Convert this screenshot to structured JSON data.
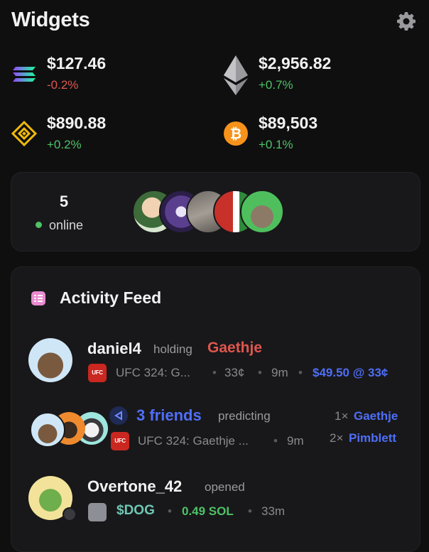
{
  "header": {
    "title": "Widgets",
    "settings_icon": "gear-icon"
  },
  "tickers": [
    {
      "symbol": "SOL",
      "icon": "solana-icon",
      "price": "$127.46",
      "change": "-0.2%",
      "direction": "down"
    },
    {
      "symbol": "ETH",
      "icon": "ethereum-icon",
      "price": "$2,956.82",
      "change": "+0.7%",
      "direction": "up"
    },
    {
      "symbol": "BNB",
      "icon": "bnb-icon",
      "price": "$890.88",
      "change": "+0.2%",
      "direction": "up"
    },
    {
      "symbol": "BTC",
      "icon": "bitcoin-icon",
      "price": "$89,503",
      "change": "+0.1%",
      "direction": "up"
    }
  ],
  "online": {
    "count": "5",
    "label": "online",
    "avatar_count": 5
  },
  "feed": {
    "title": "Activity Feed",
    "items": [
      {
        "user": "daniel4",
        "verb": "holding",
        "target": "Gaethje",
        "market": "UFC 324: G...",
        "price": "33¢",
        "time": "9m",
        "position": "$49.50 @ 33¢"
      },
      {
        "user": "3 friends",
        "verb": "predicting",
        "market": "UFC 324: Gaethje ...",
        "time": "9m",
        "picks": [
          {
            "count": "1×",
            "name": "Gaethje"
          },
          {
            "count": "2×",
            "name": "Pimblett"
          }
        ]
      },
      {
        "user": "Overtone_42",
        "verb": "opened",
        "token": "$DOG",
        "amount": "0.49 SOL",
        "time": "33m"
      }
    ]
  },
  "colors": {
    "background": "#0f0f10",
    "card": "#18181a",
    "positive": "#4fc267",
    "negative": "#e0564e",
    "link_blue": "#4f6ef7",
    "token_teal": "#6fc7b5"
  }
}
